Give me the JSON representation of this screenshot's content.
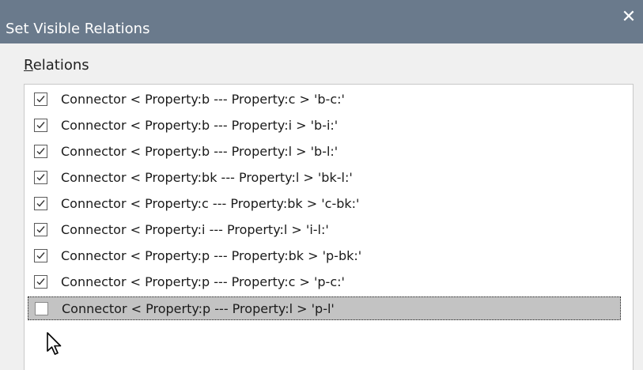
{
  "window": {
    "title": "Set Visible Relations",
    "close_glyph": "✕"
  },
  "group": {
    "label_accel": "R",
    "label_rest": "elations"
  },
  "relations": [
    {
      "label": "Connector < Property:b --- Property:c > 'b-c:'",
      "checked": true
    },
    {
      "label": "Connector < Property:b --- Property:i > 'b-i:'",
      "checked": true
    },
    {
      "label": "Connector < Property:b --- Property:l > 'b-l:'",
      "checked": true
    },
    {
      "label": "Connector < Property:bk --- Property:l > 'bk-l:'",
      "checked": true
    },
    {
      "label": "Connector < Property:c --- Property:bk > 'c-bk:'",
      "checked": true
    },
    {
      "label": "Connector < Property:i --- Property:l > 'i-l:'",
      "checked": true
    },
    {
      "label": "Connector < Property:p --- Property:bk > 'p-bk:'",
      "checked": true
    },
    {
      "label": "Connector < Property:p --- Property:c > 'p-c:'",
      "checked": true
    },
    {
      "label": "Connector < Property:p --- Property:l > 'p-l'",
      "checked": false,
      "selected": true
    }
  ],
  "icons": {
    "checkmark": "checkmark-icon",
    "cursor": "mouse-pointer-icon"
  }
}
